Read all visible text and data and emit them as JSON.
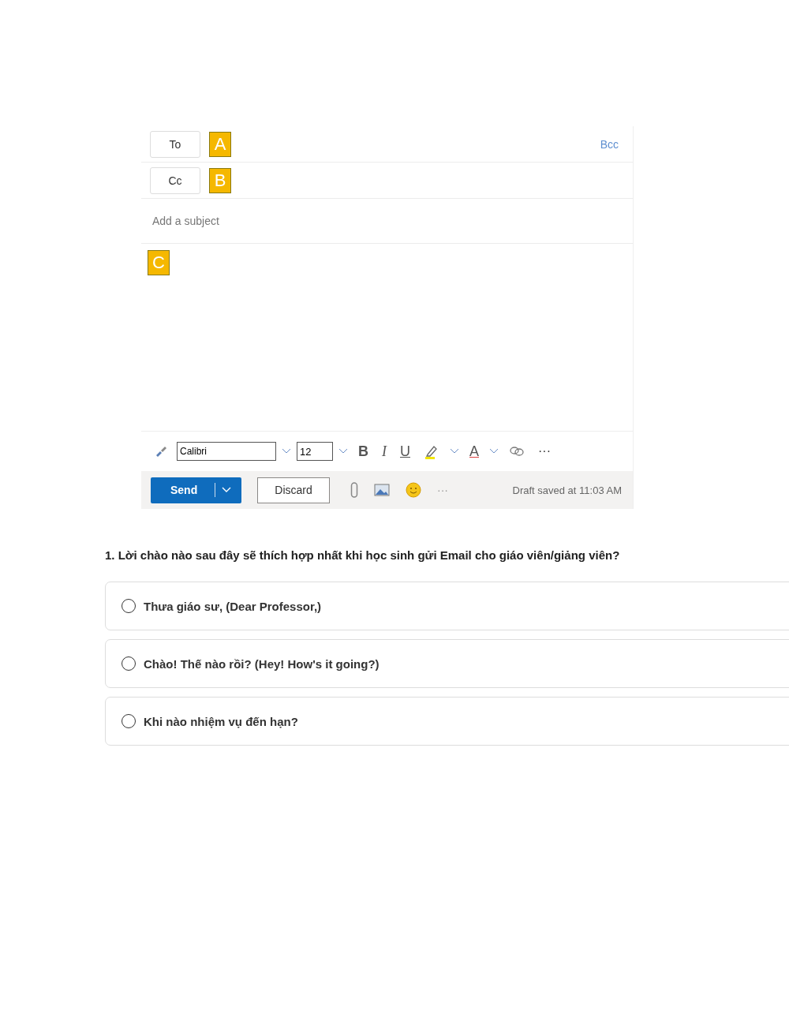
{
  "email": {
    "to_button": "To",
    "cc_button": "Cc",
    "bcc_link": "Bcc",
    "markers": [
      "A",
      "B",
      "C"
    ],
    "subject_placeholder": "Add a subject",
    "toolbar": {
      "font": "Calibri",
      "size": "12",
      "bold": "B",
      "italic": "I",
      "underline": "U",
      "font_color": "A",
      "more": "···"
    },
    "send_button": "Send",
    "discard_button": "Discard",
    "more": "···",
    "status": "Draft saved at 11:03 AM"
  },
  "question": {
    "title": "1. Lời chào nào sau đây sẽ thích hợp nhất khi học sinh gửi Email cho giáo viên/giảng viên?",
    "options": [
      {
        "label": "Thưa giáo sư, (Dear Professor,)",
        "selected": false
      },
      {
        "label": "Chào! Thế nào rồi? (Hey! How's it going?)",
        "selected": false
      },
      {
        "label": "Khi nào nhiệm vụ đến hạn?",
        "selected": false
      }
    ]
  }
}
